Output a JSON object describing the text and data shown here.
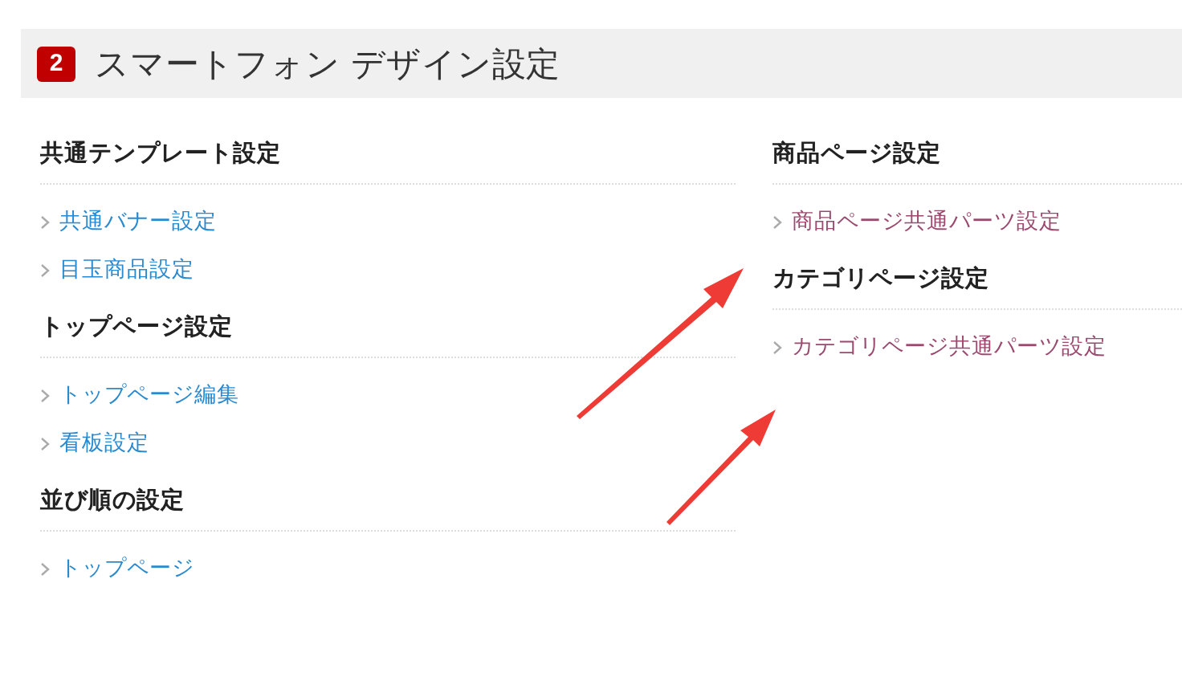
{
  "header": {
    "badge": "2",
    "title": "スマートフォン デザイン設定"
  },
  "columns": [
    {
      "sections": [
        {
          "heading": "共通テンプレート設定",
          "links": [
            {
              "label": "共通バナー設定",
              "visited": false
            },
            {
              "label": "目玉商品設定",
              "visited": false
            }
          ]
        },
        {
          "heading": "トップページ設定",
          "links": [
            {
              "label": "トップページ編集",
              "visited": false
            },
            {
              "label": "看板設定",
              "visited": false
            }
          ]
        },
        {
          "heading": "並び順の設定",
          "links": [
            {
              "label": "トップページ",
              "visited": false
            }
          ]
        }
      ]
    },
    {
      "sections": [
        {
          "heading": "商品ページ設定",
          "links": [
            {
              "label": "商品ページ共通パーツ設定",
              "visited": true
            }
          ]
        },
        {
          "heading": "カテゴリページ設定",
          "links": [
            {
              "label": "カテゴリページ共通パーツ設定",
              "visited": true
            }
          ]
        }
      ]
    }
  ]
}
